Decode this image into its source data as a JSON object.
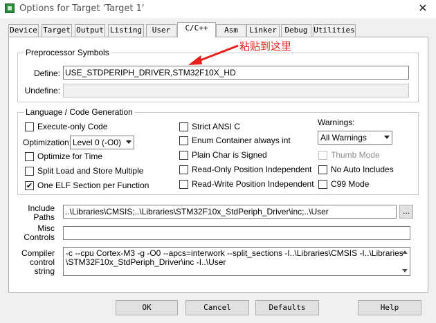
{
  "window": {
    "title": "Options for Target 'Target 1'",
    "close_glyph": "✕"
  },
  "tabs": [
    {
      "label": "Device"
    },
    {
      "label": "Target"
    },
    {
      "label": "Output"
    },
    {
      "label": "Listing"
    },
    {
      "label": "User"
    },
    {
      "label": "C/C++",
      "active": true
    },
    {
      "label": "Asm"
    },
    {
      "label": "Linker"
    },
    {
      "label": "Debug"
    },
    {
      "label": "Utilities"
    }
  ],
  "preprocessor": {
    "group_label": "Preprocessor Symbols",
    "define_label": "Define:",
    "define_value": "USE_STDPERIPH_DRIVER,STM32F10X_HD",
    "undefine_label": "Undefine:",
    "undefine_value": ""
  },
  "annotation": {
    "text": "粘贴到这里",
    "color": "#e8201c"
  },
  "language": {
    "group_label": "Language / Code Generation",
    "execute_only": {
      "label": "Execute-only Code",
      "checked": false
    },
    "optimization_label": "Optimization:",
    "optimization_value": "Level 0 (-O0)",
    "optimize_time": {
      "label": "Optimize for Time",
      "checked": false
    },
    "split_load": {
      "label": "Split Load and Store Multiple",
      "checked": false
    },
    "one_elf": {
      "label": "One ELF Section per Function",
      "checked": true,
      "mark": "✔"
    },
    "strict_ansi": {
      "label": "Strict ANSI C",
      "checked": false
    },
    "enum_container": {
      "label": "Enum Container always int",
      "checked": false
    },
    "plain_char": {
      "label": "Plain Char is Signed",
      "checked": false
    },
    "ro_pi": {
      "label": "Read-Only Position Independent",
      "checked": false
    },
    "rw_pi": {
      "label": "Read-Write Position Independent",
      "checked": false
    },
    "warnings_label": "Warnings:",
    "warnings_value": "All Warnings",
    "thumb_mode": {
      "label": "Thumb Mode",
      "checked": false,
      "disabled": true
    },
    "no_auto_includes": {
      "label": "No Auto Includes",
      "checked": false
    },
    "c99_mode": {
      "label": "C99 Mode",
      "checked": false
    }
  },
  "include_paths": {
    "label_line1": "Include",
    "label_line2": "Paths",
    "value": "..\\Libraries\\CMSIS;..\\Libraries\\STM32F10x_StdPeriph_Driver\\inc;..\\User",
    "browse_label": "..."
  },
  "misc_controls": {
    "label_line1": "Misc",
    "label_line2": "Controls",
    "value": ""
  },
  "compiler_control": {
    "label_line1": "Compiler",
    "label_line2": "control",
    "label_line3": "string",
    "line1": "-c --cpu Cortex-M3 -g -O0 --apcs=interwork --split_sections -I..\\Libraries\\CMSIS -I..\\Libraries",
    "line2": "\\STM32F10x_StdPeriph_Driver\\inc -I..\\User"
  },
  "buttons": {
    "ok": "OK",
    "cancel": "Cancel",
    "defaults": "Defaults",
    "help": "Help"
  }
}
